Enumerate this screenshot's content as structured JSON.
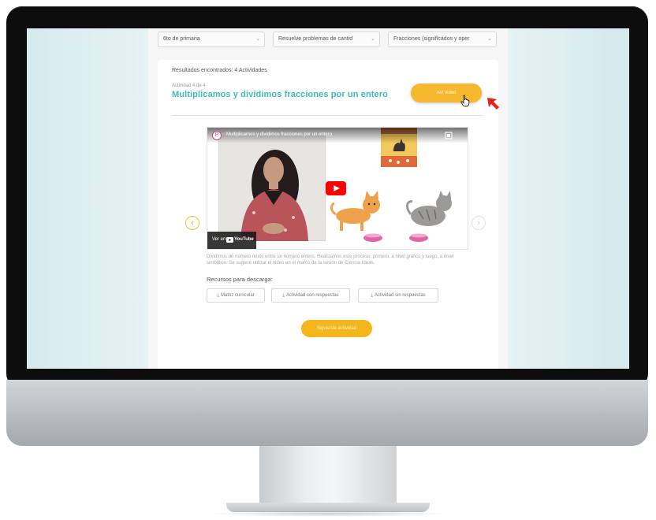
{
  "filters": [
    {
      "value": "6to de primaria"
    },
    {
      "value": "Resuelve problemas de cantid"
    },
    {
      "value": "Fracciones (significados y oper"
    }
  ],
  "results_label": "Resultados encontrados: 4 Actividades",
  "activity": {
    "counter": "Actividad 4 de 4",
    "title": "Multiplicamos y dividimos fracciones por un entero",
    "cta_label": "Ver video"
  },
  "video": {
    "title": "Multiplicamos y dividimos fracciones por un entero",
    "watch_on": "Ver en",
    "brand": "YouTube"
  },
  "description": "Dividimos un número mixto entre un número entero. Realizamos este proceso, primero, a nivel gráfico y luego, a nivel simbólico. Se sugiere utilizar el video en el marco de la sesión de Ciencia Ideas.",
  "resources": {
    "label": "Recursos para descarga:",
    "buttons": [
      {
        "label": "Matriz curricular"
      },
      {
        "label": "Actividad con respuestas"
      },
      {
        "label": "Actividad sin respuestas"
      }
    ]
  },
  "next_button": "Siguiente actividad",
  "colors": {
    "accent_teal": "#3dbcbc",
    "button_yellow": "#f5b82e",
    "arrow_red": "#e8201c"
  },
  "icons": [
    "chevron-down-icon",
    "download-icon",
    "play-icon",
    "hand-cursor-icon",
    "red-arrow-icon",
    "youtube-logo-icon",
    "chevron-left-icon",
    "chevron-right-icon",
    "share-icon"
  ]
}
